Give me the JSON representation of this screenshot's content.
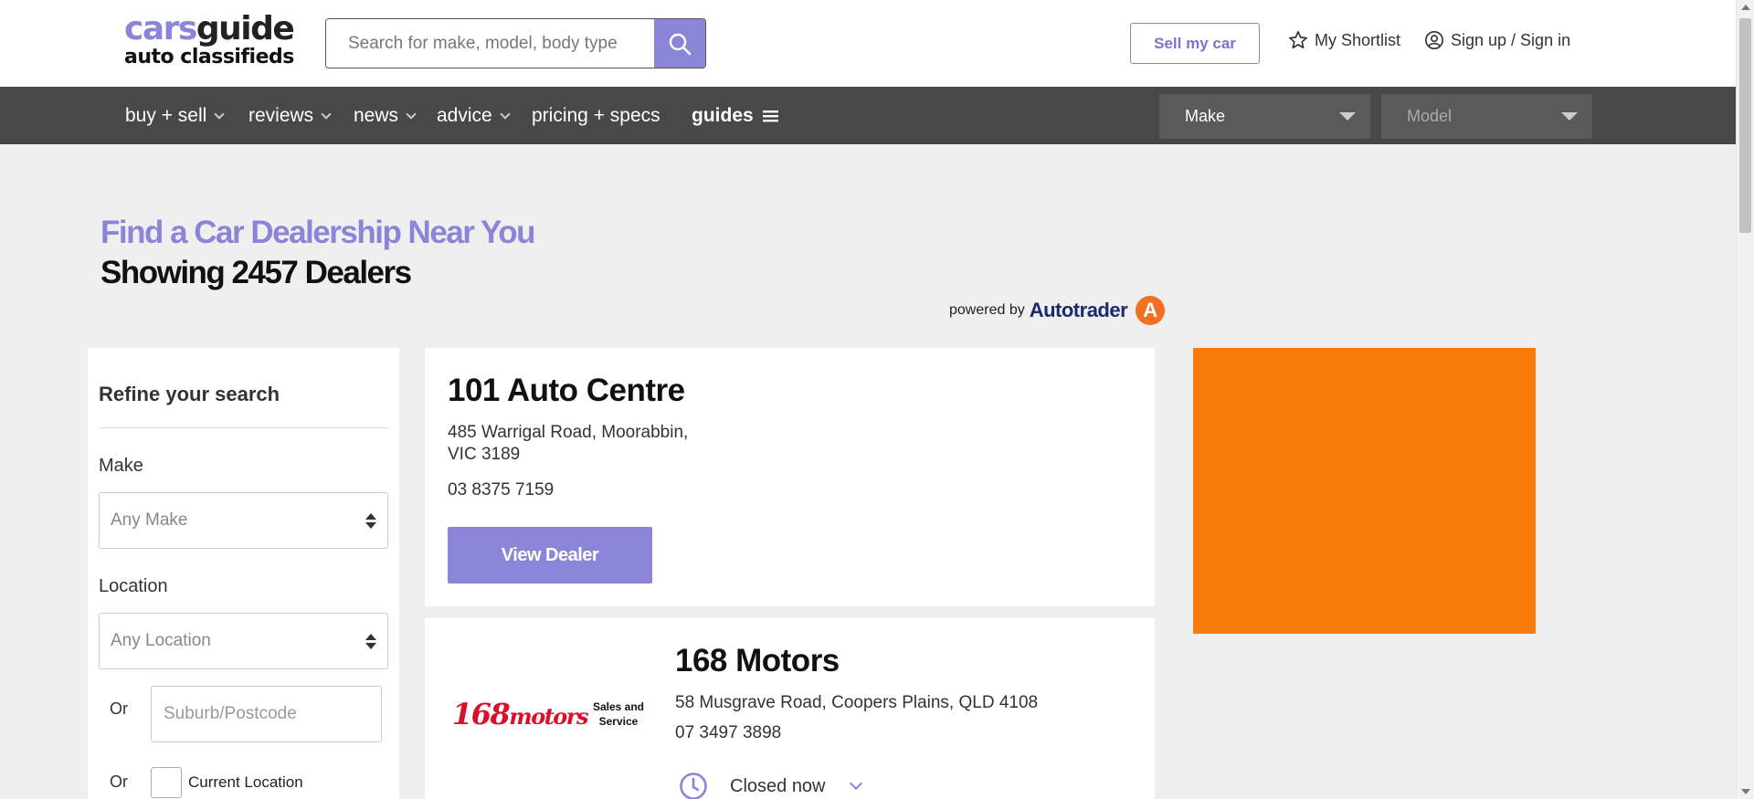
{
  "header": {
    "logo_line1_a": "cars",
    "logo_line1_b": "guide",
    "logo_line2": "auto classifieds",
    "search_placeholder": "Search for make, model, body type",
    "sell_label": "Sell my car",
    "shortlist_label": "My Shortlist",
    "signin_label": "Sign up / Sign in"
  },
  "nav": {
    "items": [
      {
        "label": "buy + sell",
        "has_dropdown": true
      },
      {
        "label": "reviews",
        "has_dropdown": true
      },
      {
        "label": "news",
        "has_dropdown": true
      },
      {
        "label": "advice",
        "has_dropdown": true
      },
      {
        "label": "pricing + specs",
        "has_dropdown": false
      },
      {
        "label": "guides",
        "has_dropdown": false
      }
    ],
    "make_select": "Make",
    "model_select": "Model"
  },
  "page": {
    "heading": "Find a Car Dealership Near You",
    "subheading": "Showing 2457 Dealers",
    "powered_by": "powered by",
    "powered_brand": "Autotrader",
    "powered_logo_letter": "A"
  },
  "sidebar": {
    "title": "Refine your search",
    "make_label": "Make",
    "make_value": "Any Make",
    "location_label": "Location",
    "location_value": "Any Location",
    "or_1": "Or",
    "suburb_placeholder": "Suburb/Postcode",
    "or_2": "Or",
    "current_location_label": "Current Location"
  },
  "dealers": [
    {
      "name": "101 Auto Centre",
      "address_line1": "485 Warrigal Road, Moorabbin,",
      "address_line2": "VIC 3189",
      "phone": "03 8375 7159",
      "button": "View Dealer"
    },
    {
      "name": "168 Motors",
      "address": "58 Musgrave Road, Coopers Plains, QLD 4108",
      "phone": "07 3497 3898",
      "hours_status": "Closed now",
      "logo_text_a": "168",
      "logo_text_b": "motors",
      "logo_sub_1": "Sales and",
      "logo_sub_2": "Service"
    }
  ],
  "colors": {
    "accent": "#8b85d8",
    "nav_bg": "#484848",
    "ad_bg": "#f97b0a",
    "autotrader_orange": "#f37021"
  },
  "icons": [
    "search-icon",
    "star-icon",
    "user-circle-icon",
    "menu-icon",
    "clock-icon",
    "chevron-down-icon"
  ]
}
